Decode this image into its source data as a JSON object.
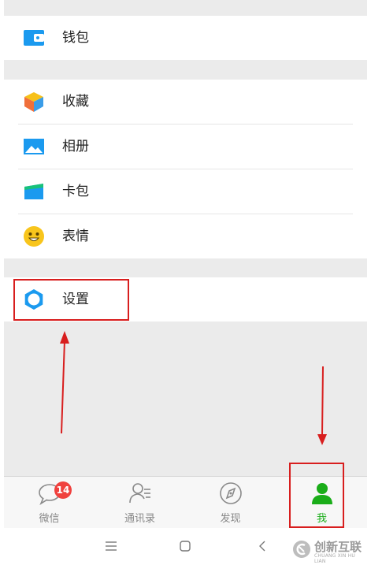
{
  "menu": {
    "wallet": {
      "label": "钱包",
      "icon": "wallet-icon"
    },
    "favorites": {
      "label": "收藏",
      "icon": "cube-icon"
    },
    "album": {
      "label": "相册",
      "icon": "photo-icon"
    },
    "cards": {
      "label": "卡包",
      "icon": "card-icon"
    },
    "stickers": {
      "label": "表情",
      "icon": "smiley-icon"
    },
    "settings": {
      "label": "设置",
      "icon": "gear-icon"
    }
  },
  "tabs": [
    {
      "label": "微信",
      "icon": "chat-bubble-icon",
      "badge": "14"
    },
    {
      "label": "通讯录",
      "icon": "contacts-icon"
    },
    {
      "label": "发现",
      "icon": "compass-icon"
    },
    {
      "label": "我",
      "icon": "person-icon",
      "active": true
    }
  ],
  "colors": {
    "accent": "#1aad19",
    "badge": "#f0413e",
    "annotation": "#d81e1e",
    "icon_blue": "#1b9aef"
  },
  "watermark": {
    "text": "创新互联",
    "sub": "CHUANG XIN HU LIAN"
  }
}
